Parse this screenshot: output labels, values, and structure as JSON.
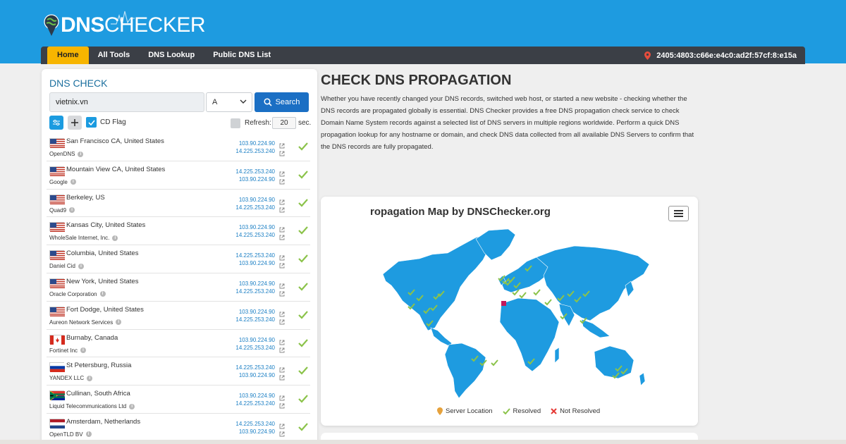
{
  "logo": {
    "bold": "DNS",
    "thin": "CHECKER"
  },
  "nav": {
    "items": [
      "Home",
      "All Tools",
      "DNS Lookup",
      "Public DNS List"
    ],
    "ip": "2405:4803:c66e:e4c0:ad2f:57cf:8:e15a"
  },
  "panel": {
    "title": "DNS CHECK",
    "domain": "vietnix.vn",
    "record_type": "A",
    "search_label": "Search",
    "cd_flag_label": "CD Flag",
    "refresh_label": "Refresh:",
    "refresh_value": "20",
    "refresh_unit": "sec."
  },
  "servers": [
    {
      "location": "San Francisco CA, United States",
      "provider": "OpenDNS",
      "ips": [
        "103.90.224.90",
        "14.225.253.240"
      ],
      "flag": "us"
    },
    {
      "location": "Mountain View CA, United States",
      "provider": "Google",
      "ips": [
        "14.225.253.240",
        "103.90.224.90"
      ],
      "flag": "us"
    },
    {
      "location": "Berkeley, US",
      "provider": "Quad9",
      "ips": [
        "103.90.224.90",
        "14.225.253.240"
      ],
      "flag": "us"
    },
    {
      "location": "Kansas City, United States",
      "provider": "WholeSale Internet, Inc.",
      "ips": [
        "103.90.224.90",
        "14.225.253.240"
      ],
      "flag": "us"
    },
    {
      "location": "Columbia, United States",
      "provider": "Daniel Cid",
      "ips": [
        "14.225.253.240",
        "103.90.224.90"
      ],
      "flag": "us"
    },
    {
      "location": "New York, United States",
      "provider": "Oracle Corporation",
      "ips": [
        "103.90.224.90",
        "14.225.253.240"
      ],
      "flag": "us"
    },
    {
      "location": "Fort Dodge, United States",
      "provider": "Aureon Network Services",
      "ips": [
        "103.90.224.90",
        "14.225.253.240"
      ],
      "flag": "us"
    },
    {
      "location": "Burnaby, Canada",
      "provider": "Fortinet Inc",
      "ips": [
        "103.90.224.90",
        "14.225.253.240"
      ],
      "flag": "ca"
    },
    {
      "location": "St Petersburg, Russia",
      "provider": "YANDEX LLC",
      "ips": [
        "14.225.253.240",
        "103.90.224.90"
      ],
      "flag": "ru"
    },
    {
      "location": "Cullinan, South Africa",
      "provider": "Liquid Telecommunications Ltd",
      "ips": [
        "103.90.224.90",
        "14.225.253.240"
      ],
      "flag": "za"
    },
    {
      "location": "Amsterdam, Netherlands",
      "provider": "OpenTLD BV",
      "ips": [
        "14.225.253.240",
        "103.90.224.90"
      ],
      "flag": "nl"
    }
  ],
  "main": {
    "title": "CHECK DNS PROPAGATION",
    "description": "Whether you have recently changed your DNS records, switched web host, or started a new website - checking whether the DNS records are propagated globally is essential. DNS Checker provides a free DNS propagation check service to check Domain Name System records against a selected list of DNS servers in multiple regions worldwide. Perform a quick DNS propagation lookup for any hostname or domain, and check DNS data collected from all available DNS Servers to confirm that the DNS records are fully propagated."
  },
  "map": {
    "title": "ropagation Map by DNSChecker.org",
    "legend": {
      "server": "Server Location",
      "resolved": "Resolved",
      "not_resolved": "Not Resolved"
    },
    "colors": {
      "land": "#1e9be0",
      "resolved": "#8bc34a",
      "not_resolved": "#e53935",
      "pin": "#e6a23c"
    }
  },
  "colors": {
    "header": "#1e9be0",
    "nav": "#3b3f46",
    "active_tab": "#f7b500",
    "link": "#1b7fc4",
    "check": "#8bc34a"
  }
}
